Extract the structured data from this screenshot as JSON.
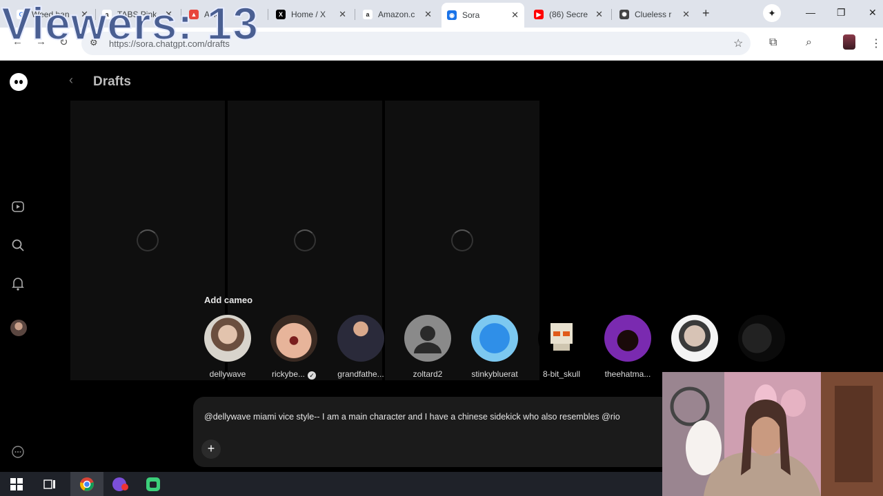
{
  "overlay": {
    "viewers": "Viewers: 13"
  },
  "browser": {
    "tabs": [
      {
        "title": "Weed ban",
        "favicon": "google-icon",
        "color": "#4285f4",
        "glyph": "G"
      },
      {
        "title": "TABS Pink",
        "favicon": "amazon-icon",
        "color": "#222222",
        "glyph": "a"
      },
      {
        "title": "Ackl",
        "favicon": "flame-icon",
        "color": "#e8453c",
        "glyph": "▲"
      },
      {
        "title": "Home / X",
        "favicon": "x-icon",
        "color": "#000000",
        "glyph": "X"
      },
      {
        "title": "Amazon.c",
        "favicon": "amazon-icon",
        "color": "#222222",
        "glyph": "a"
      },
      {
        "title": "Sora",
        "favicon": "sora-icon",
        "color": "#1a73e8",
        "glyph": "◉",
        "active": true
      },
      {
        "title": "(86) Secre",
        "favicon": "youtube-icon",
        "color": "#ff0000",
        "glyph": "▶"
      },
      {
        "title": "Clueless r",
        "favicon": "openai-icon",
        "color": "#444444",
        "glyph": "✺"
      }
    ],
    "url": "https://sora.chatgpt.com/drafts"
  },
  "page": {
    "title": "Drafts",
    "cameo_heading": "Add cameo",
    "cameos": [
      {
        "name": "dellywave",
        "verified": false
      },
      {
        "name": "rickybe...",
        "verified": true
      },
      {
        "name": "grandfathe...",
        "verified": false
      },
      {
        "name": "zoltard2",
        "verified": false
      },
      {
        "name": "stinkybluerat",
        "verified": false
      },
      {
        "name": "8-bit_skull",
        "verified": false
      },
      {
        "name": "theehatma...",
        "verified": false
      },
      {
        "name": "",
        "verified": false
      }
    ],
    "prompt": "@dellywave miami vice style-- I am a main character and I have a chinese sidekick who also resembles @rio"
  },
  "colors": {
    "accent": "#1a73e8",
    "background": "#000000",
    "composer": "#1b1b1b"
  }
}
